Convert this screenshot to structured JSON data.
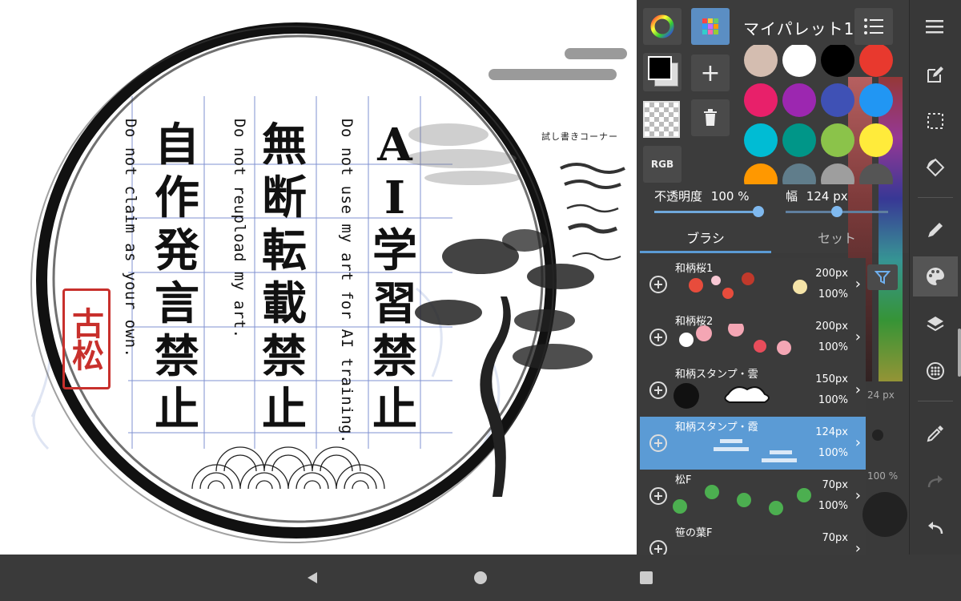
{
  "canvas": {
    "vertical_lines": [
      {
        "text": "AI学習禁止"
      },
      {
        "text": "Do not use my art for AI training."
      },
      {
        "text": "無断転載禁止"
      },
      {
        "text": "Do not reupload my art."
      },
      {
        "text": "自作発言禁止"
      },
      {
        "text": "Do not claim as your own."
      }
    ],
    "seal_text": "古松",
    "trial_corner_label": "試し書きコーナー"
  },
  "palette_panel": {
    "palette_name": "マイパレット1",
    "rgb_label": "RGB",
    "add_icon": "plus-icon",
    "delete_icon": "trash-icon",
    "swatch_colors": [
      "#d4bdb0",
      "#ffffff",
      "#000000",
      "#e8392e",
      "#e8206a",
      "#9c27b0",
      "#3f51b5",
      "#2196f3",
      "#00bcd4",
      "#009688",
      "#8bc34a",
      "#ffeb3b",
      "#ff9800",
      "#607d8b",
      "#9e9e9e",
      "#555555"
    ],
    "opacity_label": "不透明度",
    "opacity_value": "100 %",
    "width_label": "幅",
    "width_value": "124 px",
    "opacity_fraction": 1.0,
    "width_fraction": 0.5
  },
  "tabs": {
    "brush": "ブラシ",
    "set": "セット"
  },
  "brushes": [
    {
      "name": "和柄桜1",
      "size": "200px",
      "opacity": "100%",
      "selected": false
    },
    {
      "name": "和柄桜2",
      "size": "200px",
      "opacity": "100%",
      "selected": false
    },
    {
      "name": "和柄スタンプ・雲",
      "size": "150px",
      "opacity": "100%",
      "selected": false
    },
    {
      "name": "和柄スタンプ・霞",
      "size": "124px",
      "opacity": "100%",
      "selected": true
    },
    {
      "name": "松F",
      "size": "70px",
      "opacity": "100%",
      "selected": false
    },
    {
      "name": "笹の葉F",
      "size": "70px",
      "opacity": "",
      "selected": false
    }
  ],
  "side_readouts": {
    "size": "24 px",
    "percent": "100 %"
  },
  "accent_color": "#5b9bd5",
  "toolbar_icons": [
    "menu-icon",
    "edit-icon",
    "select-icon",
    "rotate-icon",
    "pen-icon",
    "palette-icon",
    "layers-icon",
    "material-icon",
    "eyedropper-icon",
    "redo-icon",
    "undo-icon"
  ],
  "nav_icons": [
    "back-icon",
    "home-icon",
    "recents-icon"
  ]
}
